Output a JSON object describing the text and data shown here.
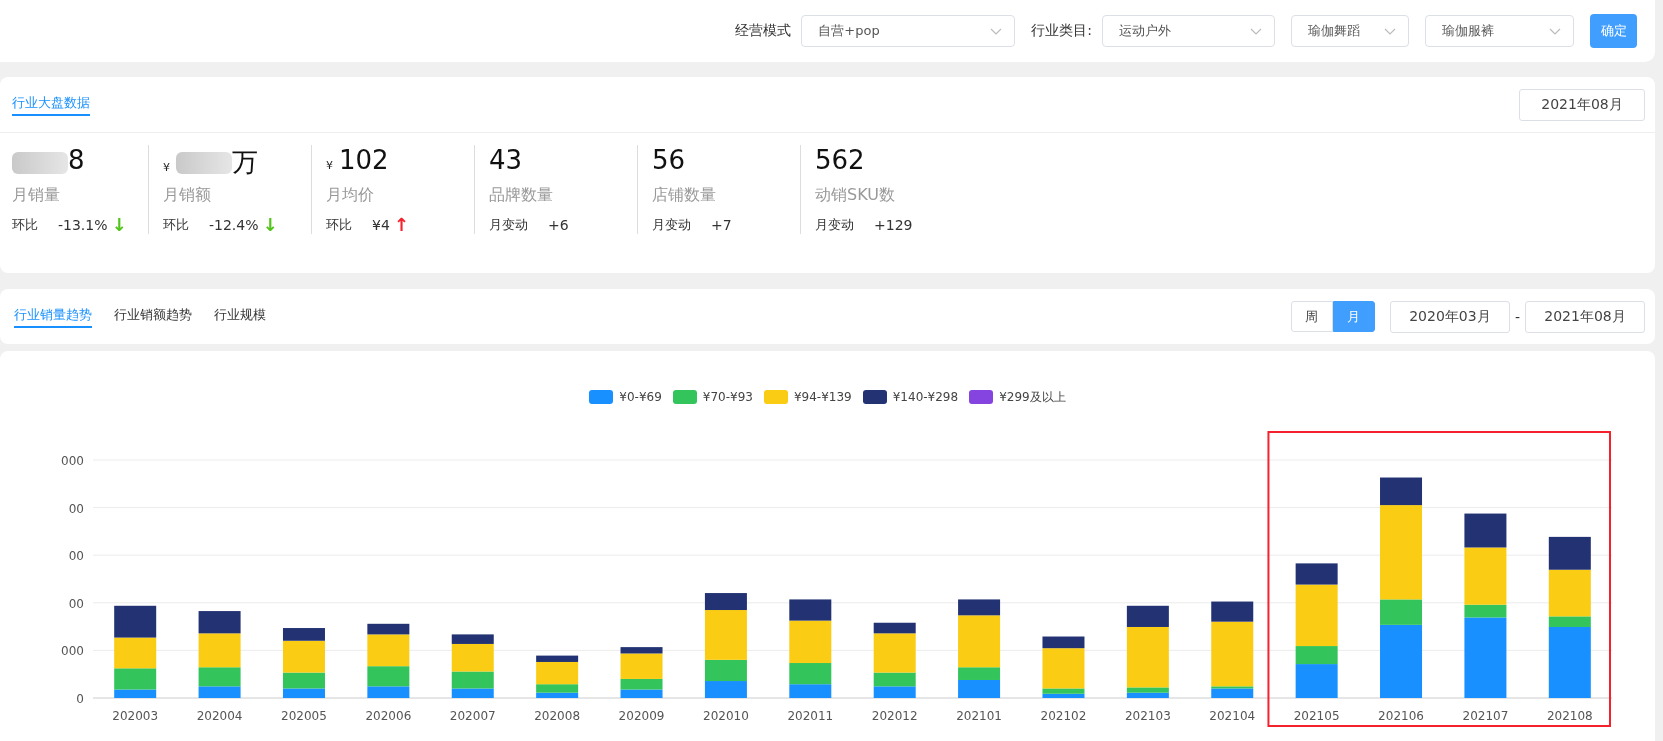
{
  "filters": [
    {
      "label": "经营模式",
      "value": "自营+pop"
    },
    {
      "label": "行业类目:",
      "value": "运动户外"
    },
    {
      "value": "瑜伽舞蹈"
    },
    {
      "value": "瑜伽服裤"
    }
  ],
  "confirm_button": "确定",
  "overview": {
    "tab": "行业大盘数据",
    "month": "2021年08月",
    "metrics": [
      {
        "value": "8",
        "blurred": true,
        "label": "月销量",
        "change_label": "环比",
        "change": "-13.1%",
        "arrow": "↓",
        "color": "#52c41a"
      },
      {
        "currency": "¥",
        "value": "万",
        "blurred": true,
        "label": "月销额",
        "change_label": "环比",
        "change": "-12.4%",
        "arrow": "↓",
        "color": "#52c41a"
      },
      {
        "currency": "¥",
        "value": "102",
        "blurred": false,
        "label": "月均价",
        "change_label": "环比",
        "change": "¥4",
        "arrow": "↑",
        "color": "#f5222d"
      },
      {
        "value": "43",
        "blurred": false,
        "label": "品牌数量",
        "change_label": "月变动",
        "change": "+6"
      },
      {
        "value": "56",
        "blurred": false,
        "label": "店铺数量",
        "change_label": "月变动",
        "change": "+7"
      },
      {
        "value": "562",
        "blurred": false,
        "label": "动销SKU数",
        "change_label": "月变动",
        "change": "+129"
      }
    ]
  },
  "trend_tabs": [
    {
      "label": "行业销量趋势",
      "selected": true
    },
    {
      "label": "行业销额趋势",
      "selected": false
    },
    {
      "label": "行业规模",
      "selected": false
    }
  ],
  "period_toggle": [
    {
      "label": "周",
      "selected": false
    },
    {
      "label": "月",
      "selected": true
    }
  ],
  "date_range": {
    "start": "2020年03月",
    "separator": "-",
    "end": "2021年08月"
  },
  "chart": {
    "legend": [
      {
        "label": "¥0-¥69",
        "color": "#1890ff"
      },
      {
        "label": "¥70-¥93",
        "color": "#33c45c"
      },
      {
        "label": "¥94-¥139",
        "color": "#facc14"
      },
      {
        "label": "¥140-¥298",
        "color": "#223273"
      },
      {
        "label": "¥299及以上",
        "color": "#8543e0"
      }
    ],
    "y_labels": [
      "000",
      "00",
      "00",
      "00",
      "000",
      "0"
    ],
    "categories": [
      {
        "label": "202003",
        "highlighted": false
      },
      {
        "label": "202004",
        "highlighted": false
      },
      {
        "label": "202005",
        "highlighted": false
      },
      {
        "label": "202006",
        "highlighted": false
      },
      {
        "label": "202007",
        "highlighted": false
      },
      {
        "label": "202008",
        "highlighted": false
      },
      {
        "label": "202009",
        "highlighted": false
      },
      {
        "label": "202010",
        "highlighted": false
      },
      {
        "label": "202011",
        "highlighted": false
      },
      {
        "label": "202012",
        "highlighted": false
      },
      {
        "label": "202101",
        "highlighted": false
      },
      {
        "label": "202102",
        "highlighted": false
      },
      {
        "label": "202103",
        "highlighted": false
      },
      {
        "label": "202104",
        "highlighted": false
      },
      {
        "label": "202105",
        "highlighted": true
      },
      {
        "label": "202106",
        "highlighted": true
      },
      {
        "label": "202107",
        "highlighted": true
      },
      {
        "label": "202108",
        "highlighted": true
      }
    ]
  }
}
